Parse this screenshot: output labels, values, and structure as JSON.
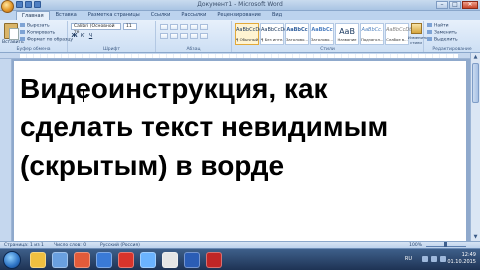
{
  "window": {
    "title": "Документ1 - Microsoft Word",
    "minimize": "–",
    "maximize": "□",
    "close": "✕"
  },
  "tabs": [
    "Главная",
    "Вставка",
    "Разметка страницы",
    "Ссылки",
    "Рассылки",
    "Рецензирование",
    "Вид"
  ],
  "ribbon": {
    "clipboard": {
      "paste": "Вставить",
      "cut": "Вырезать",
      "copy": "Копировать",
      "format_painter": "Формат по образцу",
      "label": "Буфер обмена"
    },
    "font": {
      "name": "Calibri (Основной те",
      "size": "11",
      "bold": "Ж",
      "italic": "К",
      "underline": "Ч",
      "label": "Шрифт"
    },
    "paragraph": {
      "label": "Абзац"
    },
    "styles": {
      "label": "Стили",
      "items": [
        {
          "sample": "AaBbCcDc",
          "name": "¶ Обычный"
        },
        {
          "sample": "AaBbCcDc",
          "name": "¶ Без инте..."
        },
        {
          "sample": "AaBbCc",
          "name": "Заголово..."
        },
        {
          "sample": "AaBbCc",
          "name": "Заголово..."
        },
        {
          "sample": "AaB",
          "name": "Название"
        },
        {
          "sample": "AaBbCc.",
          "name": "Подзагол..."
        },
        {
          "sample": "AaBbCcDt",
          "name": "Слабое в..."
        }
      ],
      "change_styles": "Изменить стили"
    },
    "editing": {
      "find": "Найти",
      "replace": "Заменить",
      "select": "Выделить",
      "label": "Редактирование"
    }
  },
  "document": {
    "lines": [
      "Видеоинструкция, как",
      "сделать текст невидимым",
      "(скрытым) в ворде"
    ]
  },
  "statusbar": {
    "page": "Страница: 1 из 1",
    "words": "Число слов: 0",
    "language": "Русский (Россия)",
    "zoom": "100%"
  },
  "taskbar": {
    "lang": "RU",
    "time": "12:49",
    "date": "01.10.2015"
  }
}
